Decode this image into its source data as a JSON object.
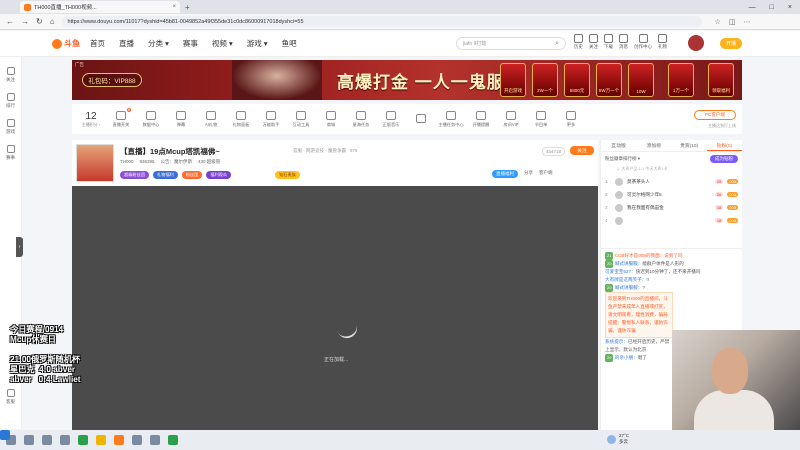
{
  "browser": {
    "tab_title": "TH000直播_TH000视频...",
    "tab_close": "×",
    "new_tab": "+",
    "window_controls": [
      "—",
      "□",
      "×"
    ],
    "url": "https://www.douyu.com/11017?dyshid=45b81-0049852a49f355de31c0dc86000917018dyshci=55",
    "nav": [
      "←",
      "→",
      "↻",
      "⌂"
    ],
    "addr_icons": [
      "☆",
      "◫",
      "⋯"
    ]
  },
  "site": {
    "logo": "斗鱼",
    "nav": [
      {
        "label": "首页",
        "active": false
      },
      {
        "label": "直播",
        "active": false
      },
      {
        "label": "分类 ▾",
        "active": false
      },
      {
        "label": "赛事",
        "active": false
      },
      {
        "label": "视频 ▾",
        "active": false
      },
      {
        "label": "游戏 ▾",
        "active": false
      },
      {
        "label": "鱼吧",
        "active": false
      }
    ],
    "search_placeholder": "jiafn 9打劫",
    "header_icons": [
      "历史",
      "关注",
      "下载",
      "消息",
      "创作中心",
      "礼物"
    ],
    "open_button": "开播"
  },
  "leftbar": {
    "items": [
      "关注",
      "排行",
      "游戏",
      "赛事"
    ],
    "bottom": "客服",
    "collapse": "›"
  },
  "banner": {
    "ad_label": "广告",
    "pill": "礼包码：VIP888",
    "title": "高爆打金 一人一鬼服",
    "slots": [
      "开启游戏",
      "2W一个",
      "5800元",
      "5W万一个",
      "10W",
      "1万一个",
      "领取福利"
    ]
  },
  "toolrow": {
    "level": "12",
    "level_label": "主播积分 ›",
    "items": [
      {
        "label": "直播开关",
        "badge": "8"
      },
      {
        "label": "数据中心",
        "badge": ""
      },
      {
        "label": "弹幕",
        "badge": ""
      },
      {
        "label": "AI礼物",
        "badge": ""
      },
      {
        "label": "礼物面板",
        "badge": ""
      },
      {
        "label": "万能助手",
        "badge": ""
      },
      {
        "label": "互动工具",
        "badge": ""
      },
      {
        "label": "商城",
        "badge": ""
      },
      {
        "label": "星海任务",
        "badge": ""
      },
      {
        "label": "正版音乐",
        "badge": ""
      },
      {
        "label": "",
        "badge": ""
      },
      {
        "label": "主播任务中心",
        "badge": ""
      },
      {
        "label": "开播提醒",
        "badge": ""
      },
      {
        "label": "房间VIP",
        "badge": ""
      },
      {
        "label": "节目单",
        "badge": ""
      },
      {
        "label": "更多",
        "badge": ""
      }
    ],
    "pc_button": "PC客户端",
    "pc_sub": "主播达到打上线"
  },
  "room": {
    "title": "【直播】19点Mcup塔凯福佛~",
    "tags": "官服 · 网游竞技 · 魔兽争霸 · 975",
    "streamer": "TH000",
    "followers": "936395",
    "notice": "公告：魔尔伊斯",
    "watching": "430 超级管",
    "badges": [
      "超级粉丝团",
      "礼物福利",
      "粉丝团",
      "福利观众"
    ],
    "gold_badge": "钻石贵族",
    "hot": "434718",
    "follow": "关注",
    "actions": [
      "直播福利",
      "分享",
      "客户端"
    ]
  },
  "video": {
    "loading": "正在加载...",
    "overlay": "今日赛程/0914\nMcup休赛日\n\n21:00俄罗斯随机杯\n星巴克  4:0 abver\nabver   0:4 Lawliet"
  },
  "rpanel": {
    "tabs": [
      {
        "label": "互动版",
        "active": false
      },
      {
        "label": "添加榜",
        "active": false
      },
      {
        "label": "贵宾(10)",
        "active": false
      },
      {
        "label": "钻粉(0)",
        "active": true
      }
    ],
    "rank_title": "粉丝徽章排行榜 ▾",
    "become": "成为钻粉",
    "rank_sub": "1. 大声产品 1-1 今天大声1卡",
    "ranks": [
      {
        "idx": "1",
        "name": "莫茶茶头人",
        "val": "29",
        "val2": "000"
      },
      {
        "idx": "2",
        "name": "可灵尔格网少年5",
        "val": "26",
        "val2": "000"
      },
      {
        "idx": "3",
        "name": "我在我面有偶宙金",
        "val": "18",
        "val2": "000"
      },
      {
        "idx": "4",
        "name": "",
        "val": "18",
        "val2": "000"
      }
    ],
    "chat": [
      {
        "tag": "21",
        "name": "",
        "text": "CCB好才是008的我面：说到了吗"
      },
      {
        "tag": "20",
        "name": "喊式讲服服：",
        "text": "能群户体件是人形的"
      },
      {
        "tag": "",
        "name": "可爱宝宝527：",
        "text": "快迟到10分钟了，还不来开播吗"
      },
      {
        "tag": "",
        "name": "大有牌是这两笑子：",
        "text": "!!"
      },
      {
        "tag": "20",
        "name": "喊式讲服服：",
        "text": "?"
      },
      {
        "tag": "",
        "name": "",
        "text": "欢迎来到TH000的直播间，斗鱼严禁未成年人直播或打赏，请文明观看，理性消费，骗局提醒：警惕私人联系，谨防诈骗，谨防诈骗"
      },
      {
        "tag": "",
        "name": "系统提示：",
        "text": "已经开启历史，严禁上显示，默认为北京"
      },
      {
        "tag": "20",
        "name": "的亲小朋：",
        "text": "唱了"
      }
    ]
  },
  "taskbar": {
    "temp": "27°C",
    "weather": "多云"
  }
}
